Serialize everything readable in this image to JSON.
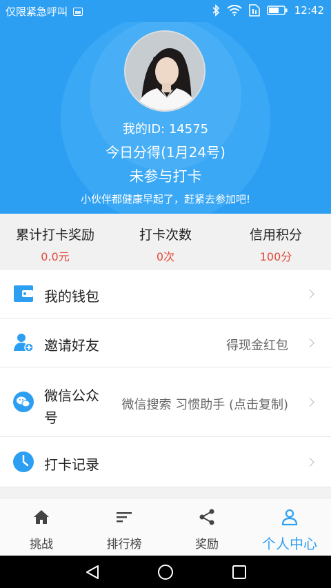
{
  "status_bar": {
    "carrier": "仅限紧急呼叫",
    "time": "12:42"
  },
  "header": {
    "user_id": "我的ID: 14575",
    "today_earn": "今日分得(1月24号)",
    "status": "未参与打卡",
    "slogan": "小伙伴都健康早起了，赶紧去参加吧!"
  },
  "stats": [
    {
      "title": "累计打卡奖励",
      "value": "0.0元"
    },
    {
      "title": "打卡次数",
      "value": "0次"
    },
    {
      "title": "信用积分",
      "value": "100分"
    }
  ],
  "menu": [
    {
      "label": "我的钱包",
      "sub": "",
      "icon": "wallet-icon"
    },
    {
      "label": "邀请好友",
      "sub": "得现金红包",
      "icon": "add-user-icon"
    },
    {
      "label_line1": "微信公众",
      "label_line2": "号",
      "sub": "微信搜索 习惯助手 (点击复制)",
      "icon": "wechat-icon"
    },
    {
      "label": "打卡记录",
      "sub": "",
      "icon": "clock-icon"
    }
  ],
  "tabs": [
    {
      "label": "挑战",
      "icon": "home-icon"
    },
    {
      "label": "排行榜",
      "icon": "ranking-icon"
    },
    {
      "label": "奖励",
      "icon": "share-icon"
    },
    {
      "label": "个人中心",
      "icon": "user-icon"
    }
  ],
  "colors": {
    "primary": "#2d9ff3",
    "value_red": "#e24b3b"
  }
}
